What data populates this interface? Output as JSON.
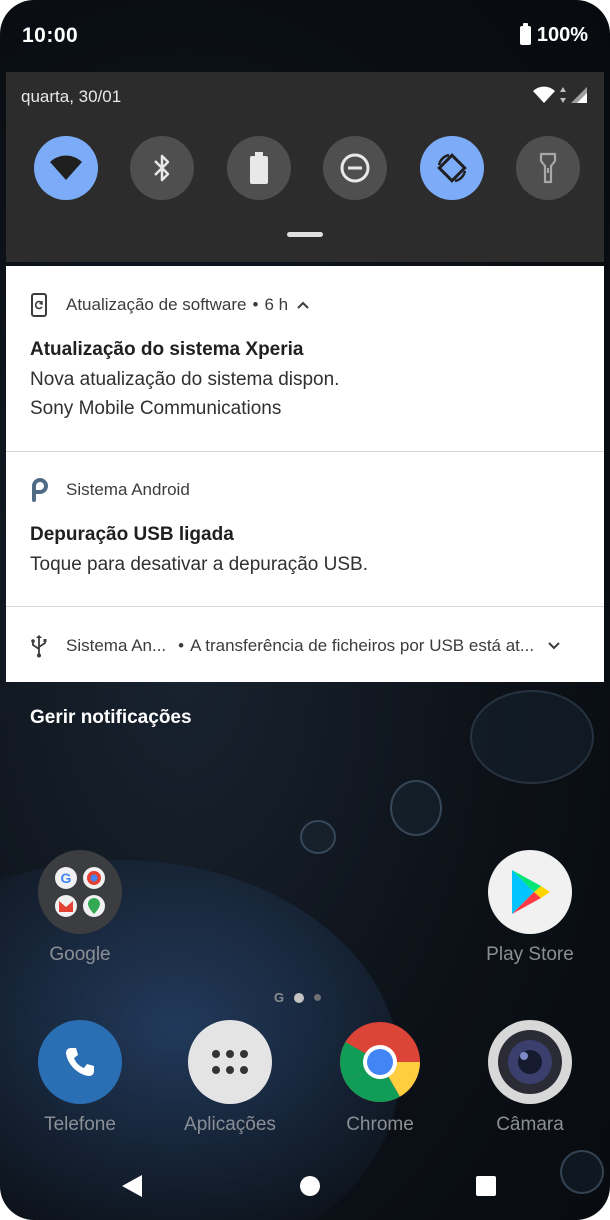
{
  "status_bar": {
    "time": "10:00",
    "battery": "100%"
  },
  "quick_settings": {
    "date": "quarta, 30/01",
    "tiles": [
      {
        "name": "wifi",
        "icon": "wifi-icon",
        "active": true
      },
      {
        "name": "bluetooth",
        "icon": "bluetooth-icon",
        "active": false
      },
      {
        "name": "battery-saver",
        "icon": "battery-icon",
        "active": false
      },
      {
        "name": "do-not-disturb",
        "icon": "minus-circle-icon",
        "active": false
      },
      {
        "name": "auto-rotate",
        "icon": "rotate-icon",
        "active": true
      },
      {
        "name": "flashlight",
        "icon": "flashlight-icon",
        "active": false
      }
    ]
  },
  "notifications": [
    {
      "app": "Atualização de software",
      "time": "6 h",
      "title": "Atualização do sistema Xperia",
      "lines": [
        "Nova atualização do sistema dispon.",
        "Sony Mobile Communications"
      ]
    },
    {
      "app": "Sistema Android",
      "title": "Depuração USB ligada",
      "lines": [
        "Toque para desativar a depuração USB."
      ]
    },
    {
      "app": "Sistema An...",
      "summary": "A transferência de ficheiros por USB está at..."
    }
  ],
  "manage_notifications": "Gerir notificações",
  "home": {
    "row1": [
      {
        "label": "Google"
      },
      {
        "label": "Play Store"
      }
    ],
    "dock": [
      {
        "label": "Telefone"
      },
      {
        "label": "Aplicações"
      },
      {
        "label": "Chrome"
      },
      {
        "label": "Câmara"
      }
    ],
    "page_marker": "G"
  },
  "colors": {
    "accent_tile": "#7cacf8",
    "tile_off": "#4f4f4f",
    "panel": "#2c2c2c"
  }
}
